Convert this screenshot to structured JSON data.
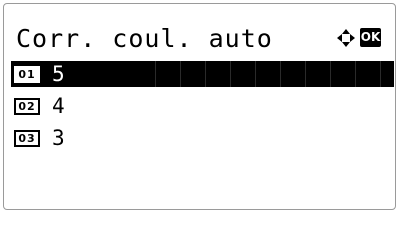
{
  "screen": {
    "title": "Corr. coul. auto",
    "nav_icon": "four-way-arrows-icon",
    "ok_label": "OK"
  },
  "options": [
    {
      "number": "01",
      "value": "5",
      "selected": true
    },
    {
      "number": "02",
      "value": "4",
      "selected": false
    },
    {
      "number": "03",
      "value": "3",
      "selected": false
    }
  ]
}
